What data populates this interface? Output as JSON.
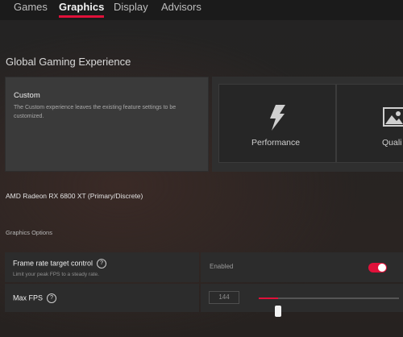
{
  "tabs": [
    {
      "label": "Games"
    },
    {
      "label": "Graphics"
    },
    {
      "label": "Display"
    },
    {
      "label": "Advisors"
    }
  ],
  "active_tab": "Graphics",
  "accent_color": "#e0113a",
  "section_title": "Global Gaming Experience",
  "presets": {
    "custom": {
      "title": "Custom",
      "description": "The Custom experience leaves the existing feature settings to be customized."
    },
    "performance": {
      "label": "Performance",
      "icon": "lightning-bolt-icon"
    },
    "quality": {
      "label": "Quali",
      "icon": "picture-icon"
    }
  },
  "gpu_name": "AMD Radeon RX 6800 XT (Primary/Discrete)",
  "graphics_options": {
    "title": "Graphics Options",
    "frame_rate_target_control": {
      "label": "Frame rate target control",
      "help": "?",
      "description": "Limit your peak FPS to a steady rate.",
      "status": "Enabled",
      "enabled": true
    },
    "max_fps": {
      "label": "Max FPS",
      "help": "?",
      "value": "144",
      "slider_fraction": 0.14
    }
  }
}
